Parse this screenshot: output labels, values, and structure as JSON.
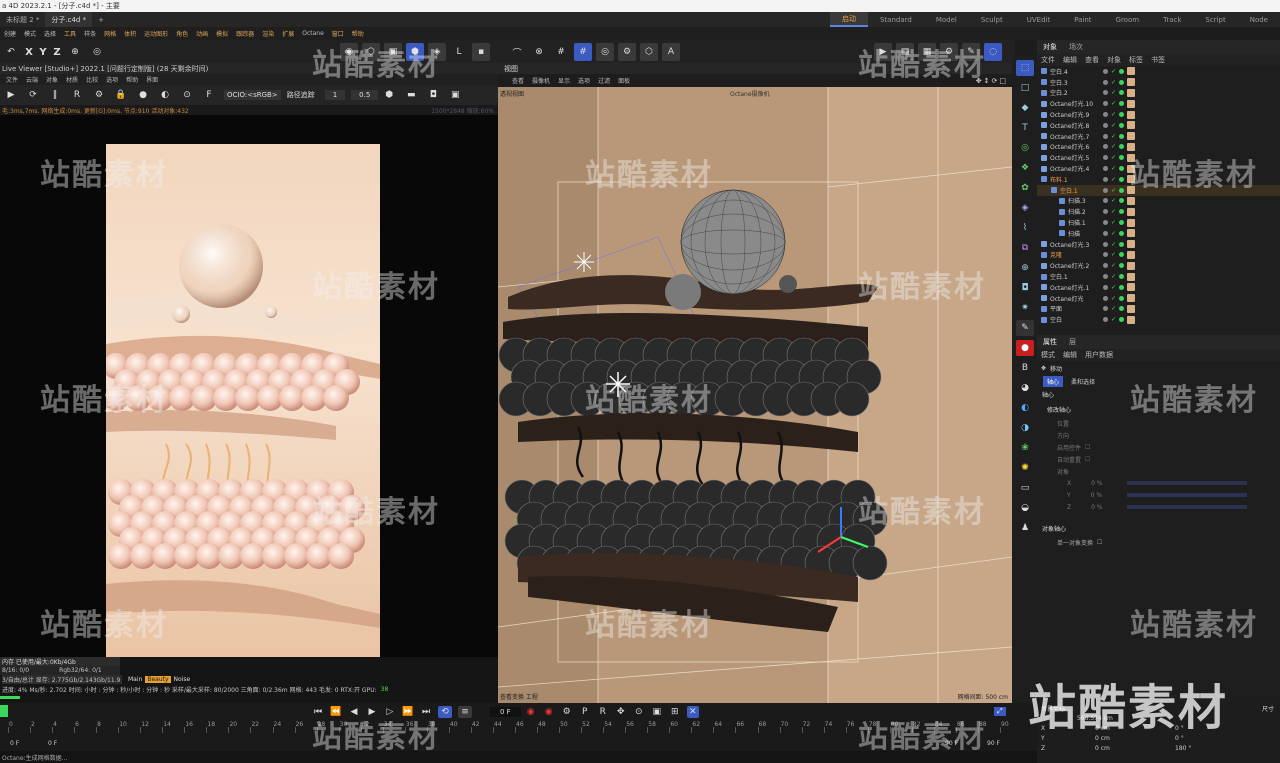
{
  "titlebar": {
    "title": "a 4D 2023.2.1 - [分子.c4d *] - 主要"
  },
  "doc_tabs": [
    "未标题 2 *",
    "分子.c4d *"
  ],
  "add_tab": "+",
  "layouts": [
    "启动",
    "Standard",
    "Model",
    "Sculpt",
    "UVEdit",
    "Paint",
    "Groom",
    "Track",
    "Script",
    "Node"
  ],
  "menus": [
    "创建",
    "模式",
    "选择",
    "工具",
    "样条",
    "网格",
    "体积",
    "运动图形",
    "角色",
    "动画",
    "模拟",
    "跟踪器",
    "渲染",
    "扩展",
    "Octane",
    "窗口",
    "帮助"
  ],
  "axes": [
    "X",
    "Y",
    "Z"
  ],
  "live_viewer": {
    "title": "Live Viewer [Studio+] 2022.1 [问题行定制版] (28 天剩余时间)",
    "menu": [
      "文件",
      "云端",
      "对象",
      "材质",
      "比较",
      "选项",
      "帮助",
      "界面"
    ],
    "ocio": "OCIO:<sRGB>",
    "render_mode": "路径追踪",
    "value1": "1",
    "value2": "0.5",
    "status": "毛:3ms,7ms. 网络生成:0ms. 更新[G]:0ms. 节点:910 活动对象:432",
    "size_label": "1500*2848 缩放:60%",
    "info": {
      "line1": "内存 已使用/最大:0Kb/4Gb",
      "line2": "8/16: 0/0",
      "line2b": "Rgb32/64: 0/1",
      "line3": "3/自由/总计 显存: 2.775Gb/2.143Gb/11.9",
      "tabs": [
        "Main",
        "Beauty",
        "Noise"
      ],
      "line4": "进度: 4%   Ms/秒: 2.702   时间: 小时 : 分钟 : 秒/小时 : 分钟 : 秒   采样/最大采样: 80/2000   三角面: 0/2.36m   网格: 443   毛发: 0   RTX:开   GPU:",
      "gpu": "38"
    }
  },
  "viewport": {
    "header": "视图",
    "menu": [
      "查看",
      "摄像机",
      "显示",
      "选项",
      "过滤",
      "面板"
    ],
    "camera": "透视视图",
    "right_label": "Octane摄像机",
    "bottom_left": "查看变换   工程",
    "bottom_right": "网格间距: 500 cm"
  },
  "panel_tabs": [
    "对象",
    "场次"
  ],
  "obj_menu": [
    "文件",
    "编辑",
    "查看",
    "对象",
    "标签",
    "书签"
  ],
  "objects": [
    "空白.4",
    "空白.3",
    "空白.2",
    "Octane灯光.10",
    "Octane灯光.9",
    "Octane灯光.8",
    "Octane灯光.7",
    "Octane灯光.6",
    "Octane灯光.5",
    "Octane灯光.4",
    "布料.1",
    "空白.1",
    "扫描.3",
    "扫描.2",
    "扫描.1",
    "扫描",
    "Octane灯光.3",
    "克隆",
    "Octane灯光.2",
    "空白.1",
    "Octane灯光.1",
    "Octane灯光",
    "平面",
    "空白"
  ],
  "attr": {
    "tabs": [
      "属性",
      "层"
    ],
    "menu": [
      "模式",
      "编辑",
      "用户数据"
    ],
    "mode": "移动",
    "buttons": [
      "轴心",
      "柔和选择"
    ],
    "section": "轴心",
    "sub": "修改轴心",
    "fields": [
      "位置",
      "方向",
      "朝向"
    ],
    "checks": [
      "启用控件",
      "自动重置"
    ],
    "obj_label": "对象",
    "xyz": [
      {
        "k": "X",
        "v": "0 %"
      },
      {
        "k": "Y",
        "v": "0 %"
      },
      {
        "k": "Z",
        "v": "0 %"
      }
    ],
    "sec2": "对象轴心",
    "single": "单一对象变换"
  },
  "timeline": {
    "frame_field": "0 F",
    "start": "0 F",
    "start2": "0 F",
    "end": "90 F",
    "end2": "90 F",
    "ticks": [
      "0",
      "2",
      "4",
      "6",
      "8",
      "10",
      "12",
      "14",
      "16",
      "18",
      "20",
      "22",
      "24",
      "26",
      "28",
      "30",
      "32",
      "34",
      "36",
      "38",
      "40",
      "42",
      "44",
      "46",
      "48",
      "50",
      "52",
      "54",
      "56",
      "58",
      "60",
      "62",
      "64",
      "66",
      "68",
      "70",
      "72",
      "74",
      "76",
      "78",
      "80",
      "82",
      "84",
      "86",
      "88",
      "90"
    ],
    "status": "Octane:生成网格数据..."
  },
  "coord": {
    "header": "世界坐标",
    "right": "尺寸",
    "size": "566.574 cm",
    "rows": [
      {
        "a": "0 cm",
        "b": "0 °"
      },
      {
        "a": "0 cm",
        "b": "0 °"
      },
      {
        "a": "0 cm",
        "b": "180 °"
      }
    ],
    "labels": [
      "X",
      "Y",
      "Z"
    ]
  },
  "watermark": "站酷素材",
  "colors": {
    "accent": "#f0a050",
    "select": "#3b5ac2",
    "viewport_bg": "#b89878"
  }
}
